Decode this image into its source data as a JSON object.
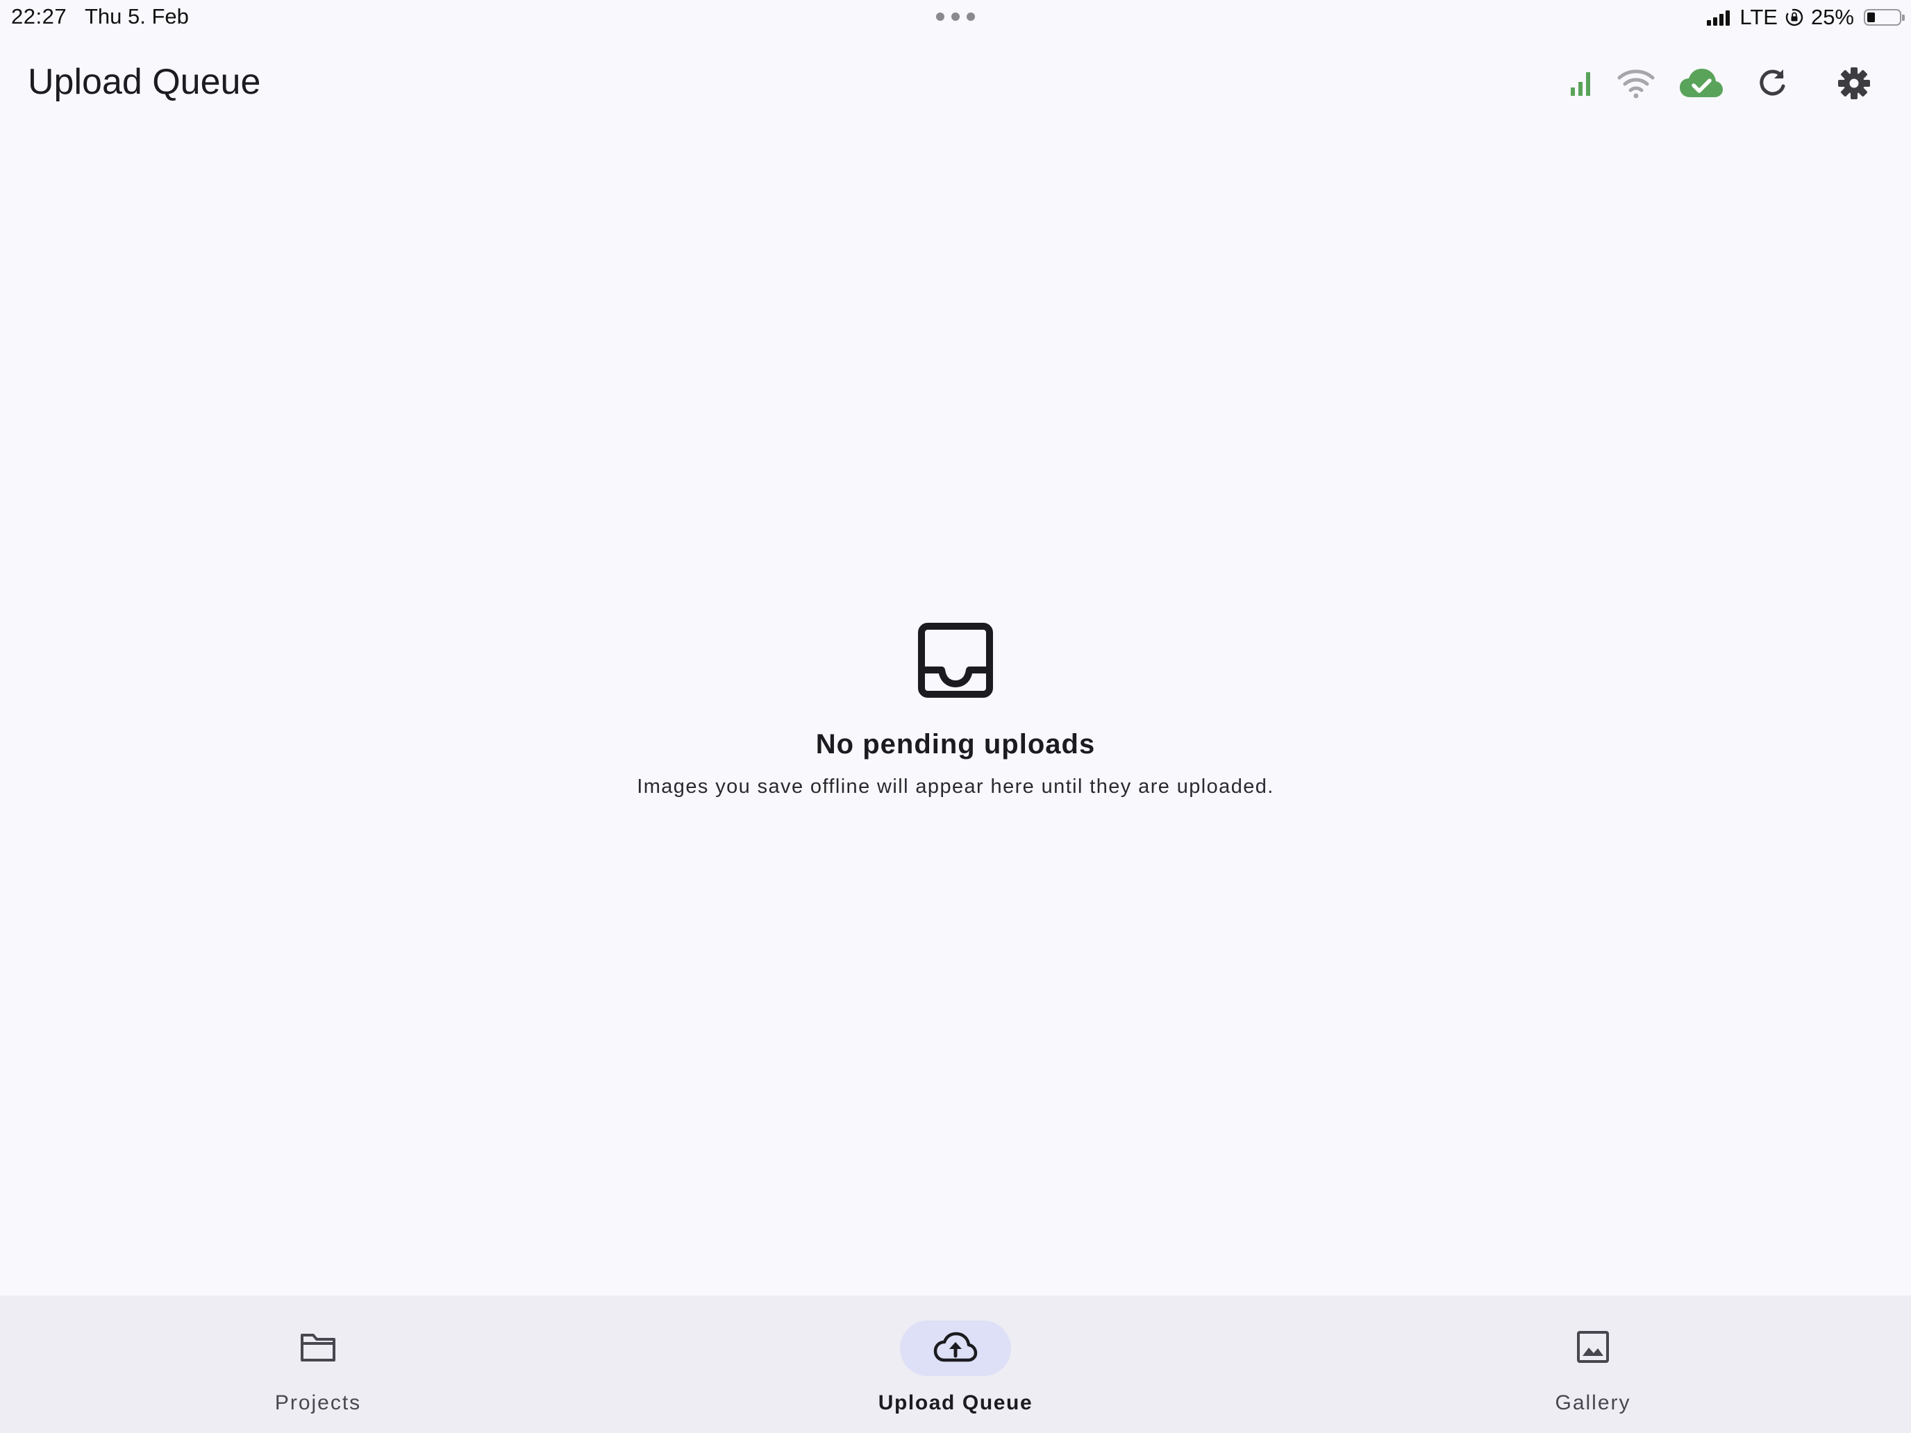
{
  "status_bar": {
    "time": "22:27",
    "date": "Thu 5. Feb",
    "network": "LTE",
    "battery_percent": "25%",
    "battery_level": 0.25
  },
  "app_bar": {
    "title": "Upload Queue",
    "actions": [
      {
        "icon": "cellular-signal-icon",
        "color": "#5aa35a"
      },
      {
        "icon": "wifi-icon",
        "color": "#a6a6ab"
      },
      {
        "icon": "cloud-done-icon",
        "color": "#5aa35a"
      },
      {
        "icon": "refresh-icon",
        "color": "#3d3d41"
      },
      {
        "icon": "settings-icon",
        "color": "#3d3d41"
      }
    ]
  },
  "empty_state": {
    "icon": "inbox-icon",
    "title": "No pending uploads",
    "subtitle": "Images you save offline will appear here until they are uploaded."
  },
  "bottom_nav": {
    "items": [
      {
        "label": "Projects",
        "icon": "folder-icon",
        "active": false
      },
      {
        "label": "Upload Queue",
        "icon": "cloud-upload-icon",
        "active": true
      },
      {
        "label": "Gallery",
        "icon": "image-icon",
        "active": false
      }
    ]
  },
  "colors": {
    "background": "#f8f8fd",
    "nav_background": "#eeedf4",
    "active_pill": "#dde0f6",
    "status_green": "#5aa35a"
  }
}
